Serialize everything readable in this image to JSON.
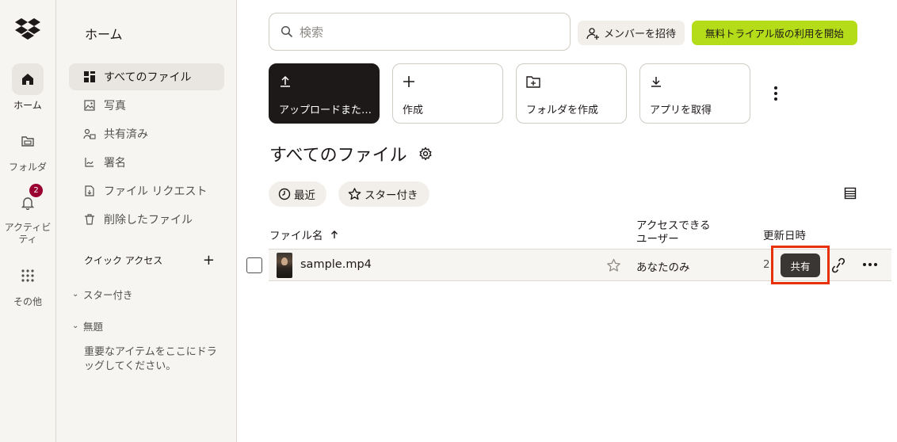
{
  "rail": {
    "items": [
      {
        "label": "ホーム",
        "icon": "home-icon"
      },
      {
        "label": "フォルダ",
        "icon": "folder-icon"
      },
      {
        "label": "アクティビティ",
        "icon": "bell-icon",
        "badge": "2"
      },
      {
        "label": "その他",
        "icon": "grid-icon"
      }
    ]
  },
  "sidebar": {
    "title": "ホーム",
    "items": [
      {
        "label": "すべてのファイル",
        "icon": "all-files-icon"
      },
      {
        "label": "写真",
        "icon": "photo-icon"
      },
      {
        "label": "共有済み",
        "icon": "shared-icon"
      },
      {
        "label": "署名",
        "icon": "signature-icon"
      },
      {
        "label": "ファイル リクエスト",
        "icon": "file-request-icon"
      },
      {
        "label": "削除したファイル",
        "icon": "trash-icon"
      }
    ],
    "quick_access": {
      "label": "クイック アクセス",
      "add": "+"
    },
    "folders": [
      {
        "label": "スター付き"
      },
      {
        "label": "無題"
      }
    ],
    "drag_hint": "重要なアイテムをここにドラッグしてください。"
  },
  "header": {
    "search_placeholder": "検索",
    "invite_label": "メンバーを招待",
    "trial_label": "無料トライアル版の利用を開始"
  },
  "actions": [
    {
      "label": "アップロードまた…",
      "icon": "upload-icon"
    },
    {
      "label": "作成",
      "icon": "plus-icon"
    },
    {
      "label": "フォルダを作成",
      "icon": "new-folder-icon"
    },
    {
      "label": "アプリを取得",
      "icon": "download-icon"
    }
  ],
  "main": {
    "title": "すべてのファイル",
    "filters": [
      {
        "label": "最近",
        "icon": "clock-icon"
      },
      {
        "label": "スター付き",
        "icon": "star-icon"
      }
    ],
    "columns": {
      "name": "ファイル名",
      "access_line1": "アクセスできる",
      "access_line2": "ユーザー",
      "modified": "更新日時"
    },
    "files": [
      {
        "name": "sample.mp4",
        "access": "あなたのみ",
        "modified": "2",
        "share_label": "共有"
      }
    ]
  },
  "colors": {
    "trial_accent": "#b4dc19",
    "highlight": "#e8300b",
    "badge": "#9b0032"
  }
}
